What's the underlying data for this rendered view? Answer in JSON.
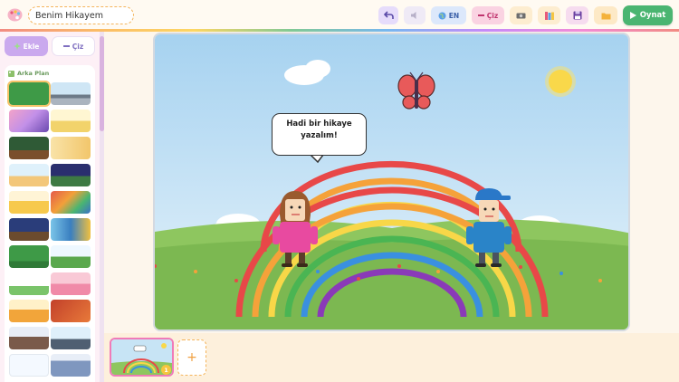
{
  "app": {
    "story_title": "Benim Hikayem"
  },
  "toolbar": {
    "undo_icon": "undo-icon",
    "sound_icon": "speaker-icon",
    "language_label": "EN",
    "draw_label": "Çiz",
    "camera_icon": "camera-icon",
    "books_icon": "books-icon",
    "save_icon": "floppy-icon",
    "folder_icon": "folder-icon",
    "play_label": "Oynat"
  },
  "sidebar": {
    "tabs": [
      {
        "label": "Ekle",
        "active": true
      },
      {
        "label": "Çiz",
        "active": false
      }
    ],
    "section_title": "Arka Plan",
    "selected_background": 0
  },
  "stage": {
    "speech_bubble": "Hadi bir hikaye yazalım!",
    "characters": [
      "girl-character",
      "boy-character",
      "butterfly",
      "sun",
      "rainbow"
    ]
  },
  "timeline": {
    "scene_number": "1",
    "add_scene_label": "+"
  },
  "colors": {
    "play": "#4ab571",
    "accent_pink": "#f07bb8",
    "dash_orange": "#f4b45a"
  }
}
